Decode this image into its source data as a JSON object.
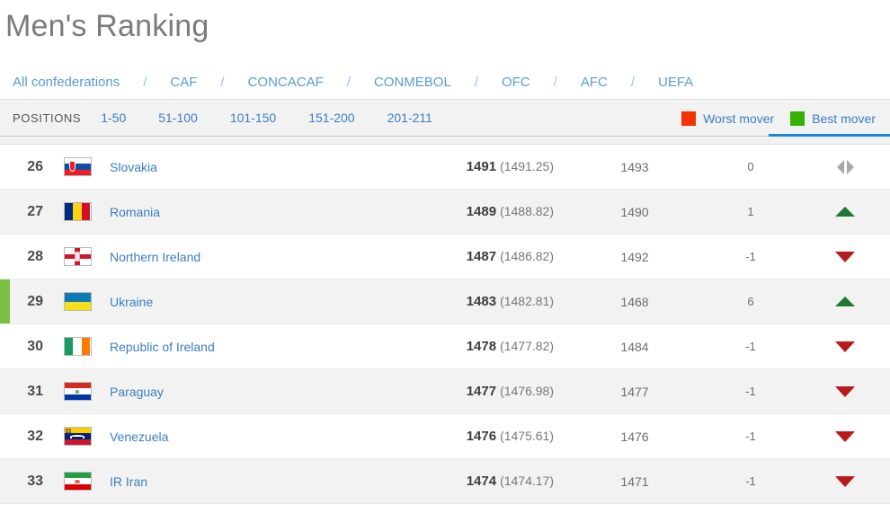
{
  "header": {
    "title": "Men's Ranking"
  },
  "confederations": {
    "separator": "/",
    "items": [
      {
        "label": "All confederations"
      },
      {
        "label": "CAF"
      },
      {
        "label": "CONCACAF"
      },
      {
        "label": "CONMEBOL"
      },
      {
        "label": "OFC"
      },
      {
        "label": "AFC"
      },
      {
        "label": "UEFA"
      }
    ]
  },
  "filter_bar": {
    "positions_label": "POSITIONS",
    "ranges": [
      {
        "label": "1-50"
      },
      {
        "label": "51-100"
      },
      {
        "label": "101-150"
      },
      {
        "label": "151-200"
      },
      {
        "label": "201-211"
      }
    ],
    "movers": [
      {
        "label": "Worst mover",
        "color": "#f43200",
        "name": "worst-mover"
      },
      {
        "label": "Best mover",
        "color": "#35b200",
        "name": "best-mover"
      }
    ],
    "active_underline_color": "#1b86dd"
  },
  "table": {
    "rows": [
      {
        "rank": "26",
        "country": "Slovakia",
        "points": "1491",
        "points_exact": "(1491.25)",
        "previous": "1493",
        "delta": "0",
        "trend": "same",
        "marker": "none",
        "shaded": false
      },
      {
        "rank": "27",
        "country": "Romania",
        "points": "1489",
        "points_exact": "(1488.82)",
        "previous": "1490",
        "delta": "1",
        "trend": "up",
        "marker": "none",
        "shaded": true
      },
      {
        "rank": "28",
        "country": "Northern Ireland",
        "points": "1487",
        "points_exact": "(1486.82)",
        "previous": "1492",
        "delta": "-1",
        "trend": "down",
        "marker": "none",
        "shaded": false
      },
      {
        "rank": "29",
        "country": "Ukraine",
        "points": "1483",
        "points_exact": "(1482.81)",
        "previous": "1468",
        "delta": "6",
        "trend": "up",
        "marker": "#7ac143",
        "shaded": true
      },
      {
        "rank": "30",
        "country": "Republic of Ireland",
        "points": "1478",
        "points_exact": "(1477.82)",
        "previous": "1484",
        "delta": "-1",
        "trend": "down",
        "marker": "none",
        "shaded": false
      },
      {
        "rank": "31",
        "country": "Paraguay",
        "points": "1477",
        "points_exact": "(1476.98)",
        "previous": "1477",
        "delta": "-1",
        "trend": "down",
        "marker": "none",
        "shaded": true
      },
      {
        "rank": "32",
        "country": "Venezuela",
        "points": "1476",
        "points_exact": "(1475.61)",
        "previous": "1476",
        "delta": "-1",
        "trend": "down",
        "marker": "none",
        "shaded": false
      },
      {
        "rank": "33",
        "country": "IR Iran",
        "points": "1474",
        "points_exact": "(1474.17)",
        "previous": "1471",
        "delta": "-1",
        "trend": "down",
        "marker": "none",
        "shaded": true
      }
    ]
  }
}
